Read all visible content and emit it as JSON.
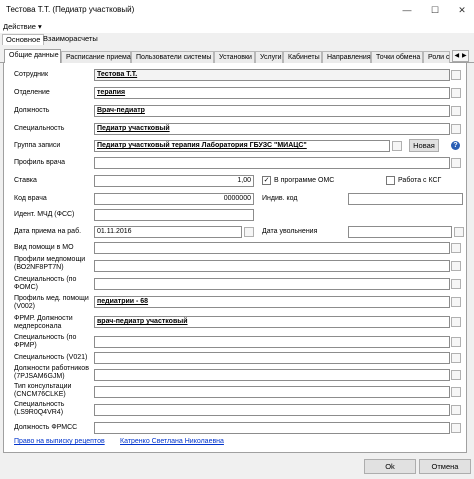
{
  "window": {
    "title": "Тестова Т.Т. (Педиатр участковый)",
    "minimize": "—",
    "maximize": "☐",
    "close": "✕"
  },
  "menu": {
    "action": "Действие ▾"
  },
  "ribbon": [
    "Основное",
    "Взаиморасчеты"
  ],
  "tabs": [
    "Общие данные",
    "Расписание приема",
    "Пользователи системы",
    "Установки",
    "Услуги",
    "Кабинеты",
    "Направления",
    "Точки обмена",
    "Роли с"
  ],
  "tab_arrows": [
    "◀",
    "▶"
  ],
  "form": {
    "employee_label": "Сотрудник",
    "employee_value": "Тестова Т.Т.",
    "department_label": "Отделение",
    "department_value": "терапия",
    "position_label": "Должность",
    "position_value": "Врач-педиатр",
    "specialty_label": "Специальность",
    "specialty_value": "Педиатр участковый",
    "group_label": "Группа записи",
    "group_value": "Педиатр участковый терапия Лаборатория ГБУЗС \"МИАЦС\"",
    "new_button": "Новая",
    "doctor_profile_label": "Профиль врача",
    "rate_label": "Ставка",
    "rate_value": "1,00",
    "oms_label": "В программе ОМС",
    "oms_checked": "✓",
    "ksg_label": "Работа с КСГ",
    "doctor_code_label": "Код врача",
    "doctor_code_value": "0000000",
    "identity_code_label": "Индив. код",
    "mcd_label": "Идент. МЧД (ФСС)",
    "hire_date_label": "Дата приема на раб.",
    "hire_date_value": "01.11.2016",
    "dismissal_label": "Дата увольнения",
    "mo_help_label": "Вид помощи в МО",
    "med_profile_label": "Профили медпомощи (ВО2NF8PT7N)",
    "foms_spec_label": "Специальность (по ФОМС)",
    "v002_label": "Профиль мед. помощи (V002)",
    "v002_value": "педиатрии - 68",
    "frmr_position_label": "ФРМР. Должности медперсонала",
    "frmr_position_value": "врач-педиатр участковый",
    "frmr_spec_label": "Специальность (по ФРМР)",
    "v021_label": "Специальность (V021)",
    "positions_label": "Должности работников (7PJSAM6GJM)",
    "consult_label": "Тип консультации (CNCM76CLKE)",
    "spec_ls_label": "Специальность (LS9R0Q4VR4)",
    "frmss_label": "Должность ФРМСС"
  },
  "links": {
    "prescription": "Право на выписку рецептов",
    "person": "Катренко Светлана Николаевна"
  },
  "buttons": {
    "ok": "Ok",
    "cancel": "Отмена"
  }
}
